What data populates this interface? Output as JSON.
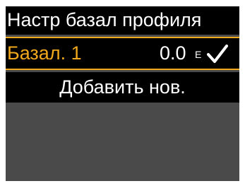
{
  "header": {
    "title": "Настр базал профиля"
  },
  "profiles": [
    {
      "label": "Базал. 1",
      "value": "0.0",
      "unit": "Е",
      "status_icon": "check-icon",
      "selected": true
    }
  ],
  "actions": {
    "add_new_label": "Добавить нов."
  },
  "colors": {
    "highlight": "#f0a81c",
    "background": "#4a4a4a",
    "row_background": "#000000",
    "text": "#ffffff"
  }
}
